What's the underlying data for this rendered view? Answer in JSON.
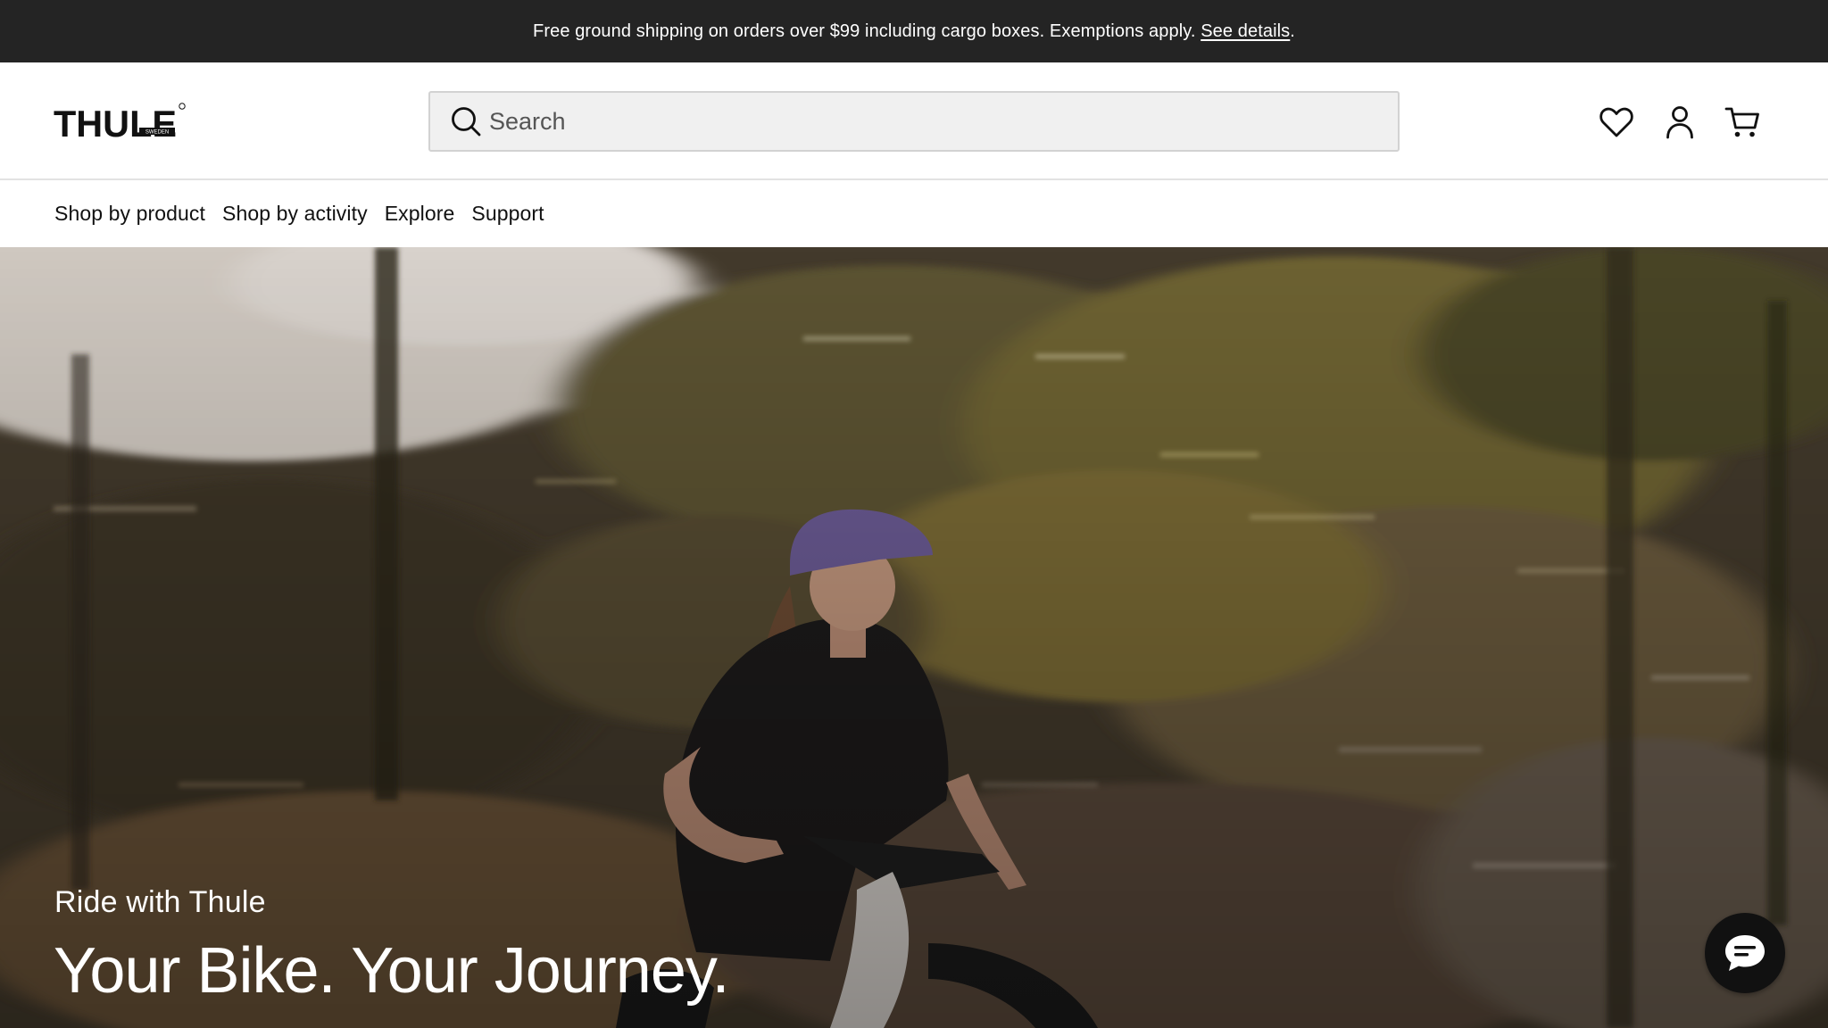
{
  "announcement": {
    "text": "Free ground shipping on orders over $99 including cargo boxes. Exemptions apply.",
    "link_label": "See details",
    "trailing": "."
  },
  "header": {
    "logo_text": "THULE",
    "logo_sub": "SWEDEN",
    "search_placeholder": "Search",
    "icons": [
      "heart-icon",
      "user-icon",
      "cart-icon"
    ]
  },
  "nav": {
    "items": [
      {
        "label": "Shop by product"
      },
      {
        "label": "Shop by activity"
      },
      {
        "label": "Explore"
      },
      {
        "label": "Support"
      }
    ]
  },
  "hero": {
    "eyebrow": "Ride with Thule",
    "headline": "Your Bike. Your Journey."
  },
  "chat": {
    "icon": "chat-bubble-icon"
  },
  "colors": {
    "announcement_bg": "#242424",
    "search_bg": "#f0f0f0",
    "text": "#111111",
    "hero_text": "#ffffff"
  }
}
